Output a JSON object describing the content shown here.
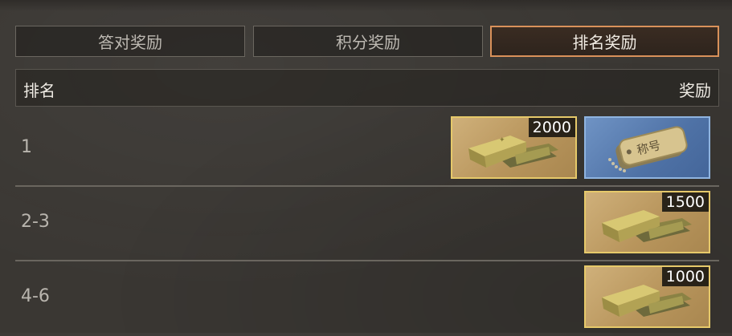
{
  "tabs": [
    {
      "label": "答对奖励",
      "active": false
    },
    {
      "label": "积分奖励",
      "active": false
    },
    {
      "label": "排名奖励",
      "active": true
    }
  ],
  "table": {
    "header": {
      "rank": "排名",
      "reward": "奖励"
    },
    "rows": [
      {
        "rank": "1",
        "rewards": [
          {
            "icon": "gold-bars-icon",
            "quantity": "2000"
          },
          {
            "icon": "dog-tag-icon",
            "label": "称号"
          }
        ]
      },
      {
        "rank": "2-3",
        "rewards": [
          {
            "icon": "gold-bars-icon",
            "quantity": "1500"
          }
        ]
      },
      {
        "rank": "4-6",
        "rewards": [
          {
            "icon": "gold-bars-icon",
            "quantity": "1000"
          }
        ]
      }
    ]
  },
  "colors": {
    "active_tab_border": "#d9915a",
    "gold_item_border": "#e6c96a",
    "blue_item_border": "#8fb4e0"
  }
}
